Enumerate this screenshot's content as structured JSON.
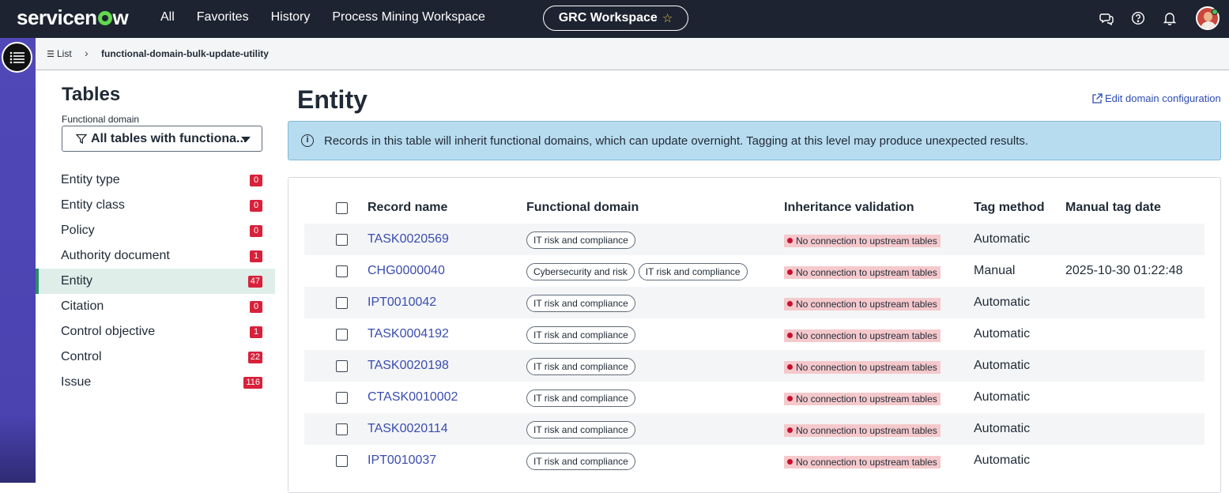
{
  "topnav": {
    "logo": "servicenow",
    "links": [
      "All",
      "Favorites",
      "History",
      "Process Mining Workspace"
    ],
    "workspace": "GRC Workspace",
    "icons": [
      "chat-icon",
      "help-icon",
      "bell-icon"
    ]
  },
  "breadcrumb": {
    "list_label": "List",
    "current": "functional-domain-bulk-update-utility"
  },
  "sidebar": {
    "title": "Tables",
    "filter_label": "Functional domain",
    "filter_value": "All tables with functiona...",
    "items": [
      {
        "label": "Entity type",
        "count": "0"
      },
      {
        "label": "Entity class",
        "count": "0"
      },
      {
        "label": "Policy",
        "count": "0"
      },
      {
        "label": "Authority document",
        "count": "1"
      },
      {
        "label": "Entity",
        "count": "47"
      },
      {
        "label": "Citation",
        "count": "0"
      },
      {
        "label": "Control objective",
        "count": "1"
      },
      {
        "label": "Control",
        "count": "22"
      },
      {
        "label": "Issue",
        "count": "116"
      }
    ],
    "active_index": 4
  },
  "main": {
    "title": "Entity",
    "edit_link": "Edit domain configuration",
    "info": "Records in this table will inherit functional domains, which can update overnight. Tagging at this level may produce unexpected results.",
    "columns": [
      "Record name",
      "Functional domain",
      "Inheritance validation",
      "Tag method",
      "Manual tag date"
    ],
    "rows": [
      {
        "name": "TASK0020569",
        "domains": [
          "IT risk and compliance"
        ],
        "inheritance": "No connection to upstream tables",
        "tag_method": "Automatic",
        "date": ""
      },
      {
        "name": "CHG0000040",
        "domains": [
          "Cybersecurity and risk",
          "IT risk and compliance"
        ],
        "inheritance": "No connection to upstream tables",
        "tag_method": "Manual",
        "date": "2025-10-30 01:22:48"
      },
      {
        "name": "IPT0010042",
        "domains": [
          "IT risk and compliance"
        ],
        "inheritance": "No connection to upstream tables",
        "tag_method": "Automatic",
        "date": ""
      },
      {
        "name": "TASK0004192",
        "domains": [
          "IT risk and compliance"
        ],
        "inheritance": "No connection to upstream tables",
        "tag_method": "Automatic",
        "date": ""
      },
      {
        "name": "TASK0020198",
        "domains": [
          "IT risk and compliance"
        ],
        "inheritance": "No connection to upstream tables",
        "tag_method": "Automatic",
        "date": ""
      },
      {
        "name": "CTASK0010002",
        "domains": [
          "IT risk and compliance"
        ],
        "inheritance": "No connection to upstream tables",
        "tag_method": "Automatic",
        "date": ""
      },
      {
        "name": "TASK0020114",
        "domains": [
          "IT risk and compliance"
        ],
        "inheritance": "No connection to upstream tables",
        "tag_method": "Automatic",
        "date": ""
      },
      {
        "name": "IPT0010037",
        "domains": [
          "IT risk and compliance"
        ],
        "inheritance": "No connection to upstream tables",
        "tag_method": "Automatic",
        "date": ""
      }
    ]
  },
  "colors": {
    "nav_bg": "#1d2330",
    "rail": "#5048b7",
    "link": "#3a4db0",
    "badge": "#d8213b",
    "active_bg": "#dfeee9",
    "banner": "#b8dcef"
  }
}
